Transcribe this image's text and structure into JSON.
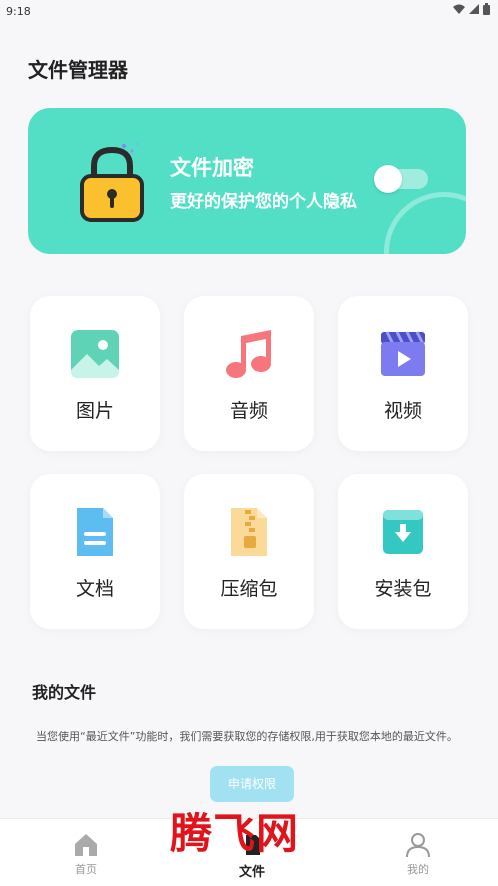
{
  "status_bar": {
    "time": "9:18"
  },
  "page": {
    "title": "文件管理器"
  },
  "banner": {
    "title": "文件加密",
    "subtitle": "更好的保护您的个人隐私",
    "toggle_on": false
  },
  "categories": [
    {
      "label": "图片",
      "icon": "image-icon",
      "color": "#5fd3b5"
    },
    {
      "label": "音频",
      "icon": "music-icon",
      "color": "#f7767c"
    },
    {
      "label": "视频",
      "icon": "video-icon",
      "color": "#7c7cf0"
    },
    {
      "label": "文档",
      "icon": "document-icon",
      "color": "#5dbcf0"
    },
    {
      "label": "压缩包",
      "icon": "archive-icon",
      "color": "#f7c66a"
    },
    {
      "label": "安装包",
      "icon": "install-package-icon",
      "color": "#35c8c3"
    }
  ],
  "my_files": {
    "title": "我的文件",
    "notice": "当您使用“最近文件”功能时，我们需要获取您的存储权限,用于获取您本地的最近文件。",
    "button": "申请权限"
  },
  "nav": [
    {
      "label": "首页",
      "icon": "home-icon",
      "active": false
    },
    {
      "label": "文件",
      "icon": "file-icon",
      "active": true
    },
    {
      "label": "我的",
      "icon": "profile-icon",
      "active": false
    }
  ],
  "watermark": "腾飞网"
}
